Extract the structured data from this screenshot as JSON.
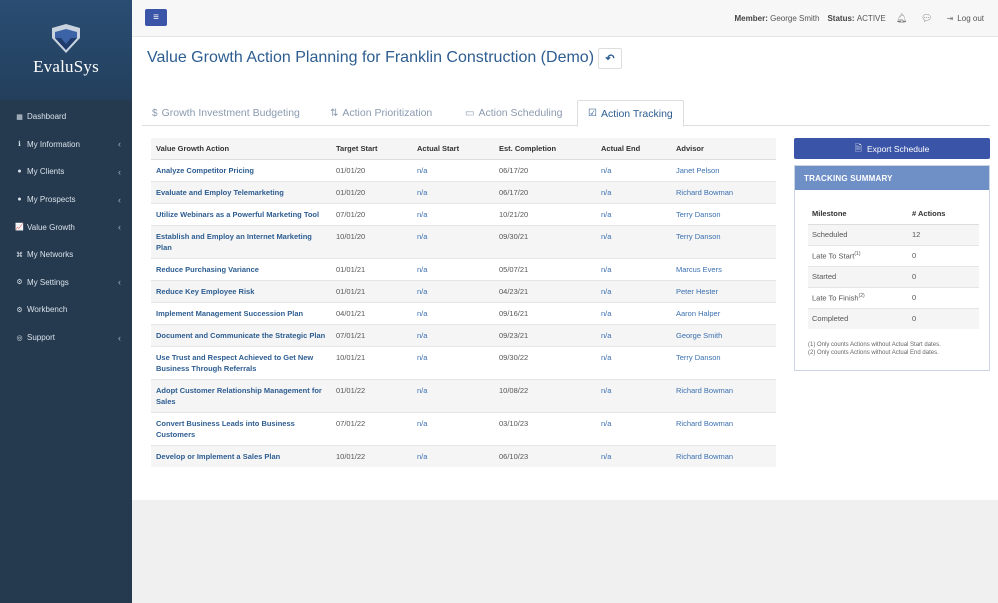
{
  "brand": {
    "name": "EvaluSys"
  },
  "sidebar": {
    "items": [
      {
        "label": "Dashboard",
        "icon": "dashboard-icon",
        "glyph": "▦",
        "chevron": false
      },
      {
        "label": "My Information",
        "icon": "info-icon",
        "glyph": "ℹ",
        "chevron": true
      },
      {
        "label": "My Clients",
        "icon": "user-icon",
        "glyph": "●",
        "chevron": true
      },
      {
        "label": "My Prospects",
        "icon": "users-icon",
        "glyph": "●",
        "chevron": true
      },
      {
        "label": "Value Growth",
        "icon": "chart-icon",
        "glyph": "📈",
        "chevron": true
      },
      {
        "label": "My Networks",
        "icon": "sitemap-icon",
        "glyph": "⌘",
        "chevron": false
      },
      {
        "label": "My Settings",
        "icon": "gear-icon",
        "glyph": "⚙",
        "chevron": true
      },
      {
        "label": "Workbench",
        "icon": "cogs-icon",
        "glyph": "⚙",
        "chevron": false
      },
      {
        "label": "Support",
        "icon": "lifebuoy-icon",
        "glyph": "◎",
        "chevron": true
      }
    ]
  },
  "topbar": {
    "member_label": "Member:",
    "member_name": "George Smith",
    "status_label": "Status:",
    "status_value": "ACTIVE",
    "logout_label": "Log out"
  },
  "page": {
    "title": "Value Growth Action Planning for Franklin Construction (Demo)"
  },
  "tabs": [
    {
      "label": "Growth Investment Budgeting",
      "glyph": "$"
    },
    {
      "label": "Action Prioritization",
      "glyph": "⇅"
    },
    {
      "label": "Action Scheduling",
      "glyph": "▭"
    },
    {
      "label": "Action Tracking",
      "glyph": "☑"
    }
  ],
  "table": {
    "headers": [
      "Value Growth Action",
      "Target Start",
      "Actual Start",
      "Est. Completion",
      "Actual End",
      "Advisor"
    ],
    "rows": [
      [
        "Analyze Competitor Pricing",
        "01/01/20",
        "n/a",
        "06/17/20",
        "n/a",
        "Janet Pelson"
      ],
      [
        "Evaluate and Employ Telemarketing",
        "01/01/20",
        "n/a",
        "06/17/20",
        "n/a",
        "Richard Bowman"
      ],
      [
        "Utilize Webinars as a Powerful Marketing Tool",
        "07/01/20",
        "n/a",
        "10/21/20",
        "n/a",
        "Terry Danson"
      ],
      [
        "Establish and Employ an Internet Marketing Plan",
        "10/01/20",
        "n/a",
        "09/30/21",
        "n/a",
        "Terry Danson"
      ],
      [
        "Reduce Purchasing Variance",
        "01/01/21",
        "n/a",
        "05/07/21",
        "n/a",
        "Marcus Evers"
      ],
      [
        "Reduce Key Employee Risk",
        "01/01/21",
        "n/a",
        "04/23/21",
        "n/a",
        "Peter Hester"
      ],
      [
        "Implement Management Succession Plan",
        "04/01/21",
        "n/a",
        "09/16/21",
        "n/a",
        "Aaron Halper"
      ],
      [
        "Document and Communicate the Strategic Plan",
        "07/01/21",
        "n/a",
        "09/23/21",
        "n/a",
        "George Smith"
      ],
      [
        "Use Trust and Respect Achieved to Get New Business Through Referrals",
        "10/01/21",
        "n/a",
        "09/30/22",
        "n/a",
        "Terry Danson"
      ],
      [
        "Adopt Customer Relationship Management for Sales",
        "01/01/22",
        "n/a",
        "10/08/22",
        "n/a",
        "Richard Bowman"
      ],
      [
        "Convert Business Leads into Business Customers",
        "07/01/22",
        "n/a",
        "03/10/23",
        "n/a",
        "Richard Bowman"
      ],
      [
        "Develop or Implement a Sales Plan",
        "10/01/22",
        "n/a",
        "06/10/23",
        "n/a",
        "Richard Bowman"
      ]
    ]
  },
  "export_button": {
    "label": "Export Schedule"
  },
  "summary": {
    "title": "TRACKING SUMMARY",
    "headers": [
      "Milestone",
      "# Actions"
    ],
    "rows": [
      {
        "milestone": "Scheduled",
        "sup": "",
        "count": "12"
      },
      {
        "milestone": "Late To Start",
        "sup": "(1)",
        "count": "0"
      },
      {
        "milestone": "Started",
        "sup": "",
        "count": "0"
      },
      {
        "milestone": "Late To Finish",
        "sup": "(2)",
        "count": "0"
      },
      {
        "milestone": "Completed",
        "sup": "",
        "count": "0"
      }
    ],
    "notes": [
      "(1) Only counts Actions without Actual Start dates.",
      "(2) Only counts Actions without Actual End dates."
    ]
  },
  "colors": {
    "sidebar": "#253a4f",
    "accent": "#3a54a8",
    "title": "#2d5d91",
    "summary_head": "#6f8fc7"
  }
}
